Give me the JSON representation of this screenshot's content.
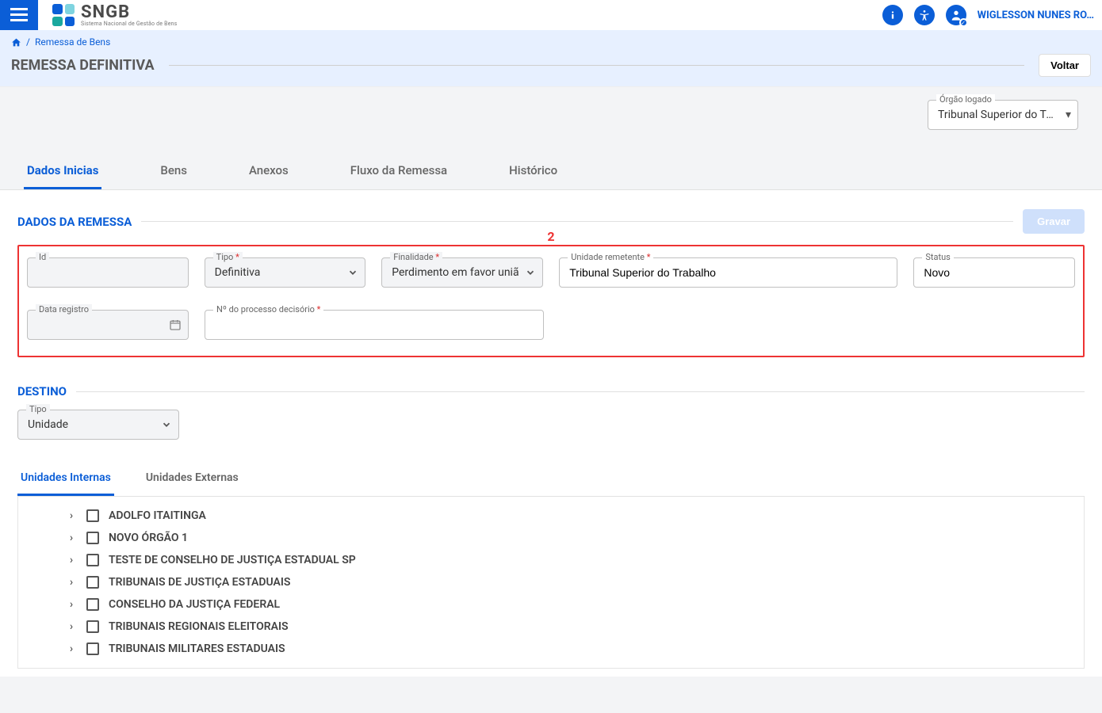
{
  "header": {
    "logo_big": "SNGB",
    "logo_small": "Sistema Nacional de Gestão de Bens",
    "username": "WIGLESSON NUNES RO…"
  },
  "breadcrumb": {
    "home_icon": "home-icon",
    "sep": "/",
    "remessa": "Remessa de Bens"
  },
  "page": {
    "title": "REMESSA DEFINITIVA",
    "voltar": "Voltar"
  },
  "orgao_logado": {
    "label": "Órgão logado",
    "value": "Tribunal Superior do Tra…"
  },
  "tabs": [
    {
      "label": "Dados Inicias",
      "active": true
    },
    {
      "label": "Bens",
      "active": false
    },
    {
      "label": "Anexos",
      "active": false
    },
    {
      "label": "Fluxo da Remessa",
      "active": false
    },
    {
      "label": "Histórico",
      "active": false
    }
  ],
  "remessa": {
    "section_title": "DADOS DA REMESSA",
    "gravar": "Gravar",
    "badge": "2",
    "fields": {
      "id": {
        "label": "Id",
        "value": "",
        "required": false
      },
      "tipo": {
        "label": "Tipo",
        "value": "Definitiva",
        "required": true
      },
      "finalidade": {
        "label": "Finalidade",
        "value": "Perdimento em favor uniã",
        "required": true
      },
      "unidade": {
        "label": "Unidade remetente",
        "value": "Tribunal Superior do Trabalho",
        "required": true
      },
      "status": {
        "label": "Status",
        "value": "Novo",
        "required": false
      },
      "data_registro": {
        "label": "Data registro",
        "value": "",
        "required": false
      },
      "num_processo": {
        "label": "Nº do processo decisório",
        "value": "",
        "required": true
      }
    }
  },
  "destino": {
    "section_title": "DESTINO",
    "tipo_label": "Tipo",
    "tipo_value": "Unidade",
    "subtabs": [
      {
        "label": "Unidades Internas",
        "active": true
      },
      {
        "label": "Unidades Externas",
        "active": false
      }
    ],
    "tree": [
      "ADOLFO ITAITINGA",
      "NOVO ÓRGÃO 1",
      "TESTE DE CONSELHO DE JUSTIÇA ESTADUAL SP",
      "TRIBUNAIS DE JUSTIÇA ESTADUAIS",
      "CONSELHO DA JUSTIÇA FEDERAL",
      "TRIBUNAIS REGIONAIS ELEITORAIS",
      "TRIBUNAIS MILITARES ESTADUAIS"
    ]
  }
}
